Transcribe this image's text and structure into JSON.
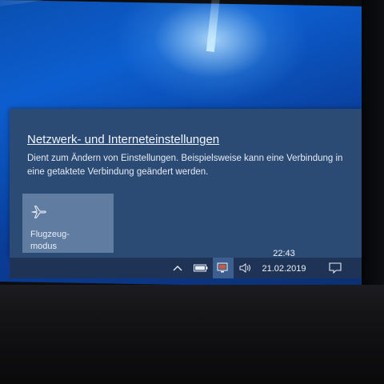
{
  "action_center": {
    "title": "Netzwerk- und Interneteinstellungen",
    "description": "Dient zum Ändern von Einstellungen. Beispielsweise kann eine Verbindung in eine getaktete Verbindung geändert werden.",
    "tiles": [
      {
        "label": "Flugzeug-\nmodus",
        "icon": "airplane-icon",
        "active": false
      }
    ]
  },
  "taskbar": {
    "icons": [
      "chevron-up-icon",
      "battery-icon",
      "network-icon",
      "volume-icon",
      "notification-icon"
    ],
    "time": "22:43",
    "date": "21.02.2019"
  },
  "colors": {
    "panel": "#2b4a74",
    "tile": "#607da1",
    "taskbar": "#1f3356"
  }
}
